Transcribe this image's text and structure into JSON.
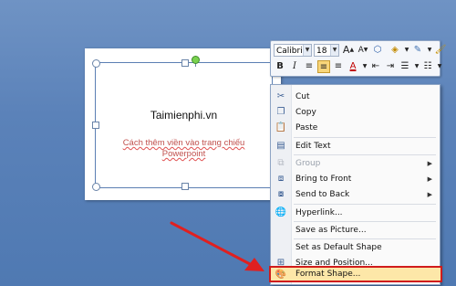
{
  "slide": {
    "title": "Taimienphi.vn",
    "subtitle_line1": "Cách thêm viền vào trang chiếu",
    "subtitle_line2": "Powerpoint"
  },
  "mini_toolbar": {
    "font_name": "Calibri (E",
    "font_size": "18"
  },
  "menu": {
    "cut": "Cut",
    "copy": "Copy",
    "paste": "Paste",
    "edit_text": "Edit Text",
    "group": "Group",
    "bring_to_front": "Bring to Front",
    "send_to_back": "Send to Back",
    "hyperlink": "Hyperlink...",
    "save_as_picture": "Save as Picture...",
    "set_default_shape": "Set as Default Shape",
    "size_position": "Size and Position...",
    "format_shape": "Format Shape..."
  },
  "colors": {
    "background": "#5b82b9",
    "highlight_border": "#d01c1c",
    "highlight_fill": "#fde7a8",
    "arrow": "#e02020"
  }
}
